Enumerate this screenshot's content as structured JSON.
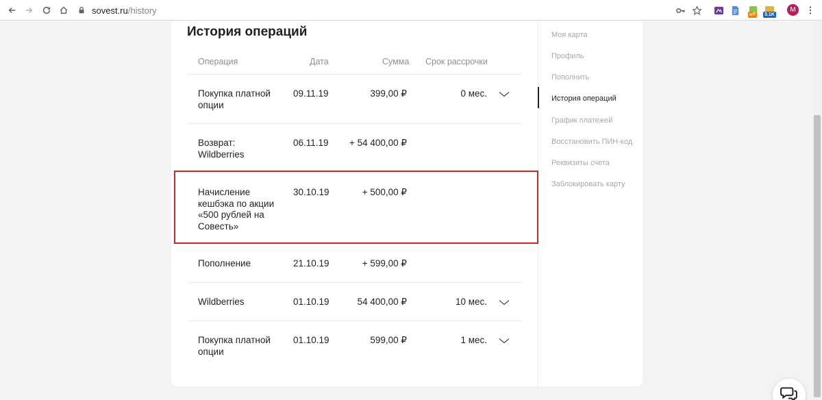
{
  "browser": {
    "url_host": "sovest.ru",
    "url_path": "/history",
    "ext_badges": {
      "off": "off",
      "count": "3.1K"
    },
    "avatar_letter": "M"
  },
  "page": {
    "title": "История операций",
    "columns": {
      "operation": "Операция",
      "date": "Дата",
      "sum": "Сумма",
      "term": "Срок рассрочки"
    },
    "rows": [
      {
        "op": "Покупка платной опции",
        "date": "09.11.19",
        "sum": "399,00 ₽",
        "term": "0 мес.",
        "expandable": true
      },
      {
        "op": "Возврат: Wildberries",
        "date": "06.11.19",
        "sum": "+ 54 400,00 ₽",
        "term": "",
        "expandable": false
      },
      {
        "op": "Начисление кешбэка по акции «500 рублей на Совесть»",
        "date": "30.10.19",
        "sum": "+ 500,00 ₽",
        "term": "",
        "expandable": false
      },
      {
        "op": "Пополнение",
        "date": "21.10.19",
        "sum": "+ 599,00 ₽",
        "term": "",
        "expandable": false
      },
      {
        "op": "Wildberries",
        "date": "01.10.19",
        "sum": "54 400,00 ₽",
        "term": "10 мес.",
        "expandable": true
      },
      {
        "op": "Покупка платной опции",
        "date": "01.10.19",
        "sum": "599,00 ₽",
        "term": "1 мес.",
        "expandable": true
      }
    ]
  },
  "side_menu": {
    "items": [
      {
        "label": "Моя карта"
      },
      {
        "label": "Профиль"
      },
      {
        "label": "Пополнить"
      },
      {
        "label": "История операций"
      },
      {
        "label": "График платежей"
      },
      {
        "label": "Восстановить ПИН-код"
      },
      {
        "label": "Реквизиты счета"
      },
      {
        "label": "Заблокировать карту"
      }
    ],
    "active_index": 3
  },
  "colors": {
    "highlight": "#c62828",
    "active_text": "#1f1f1f",
    "muted_text": "#a8a8a8"
  }
}
